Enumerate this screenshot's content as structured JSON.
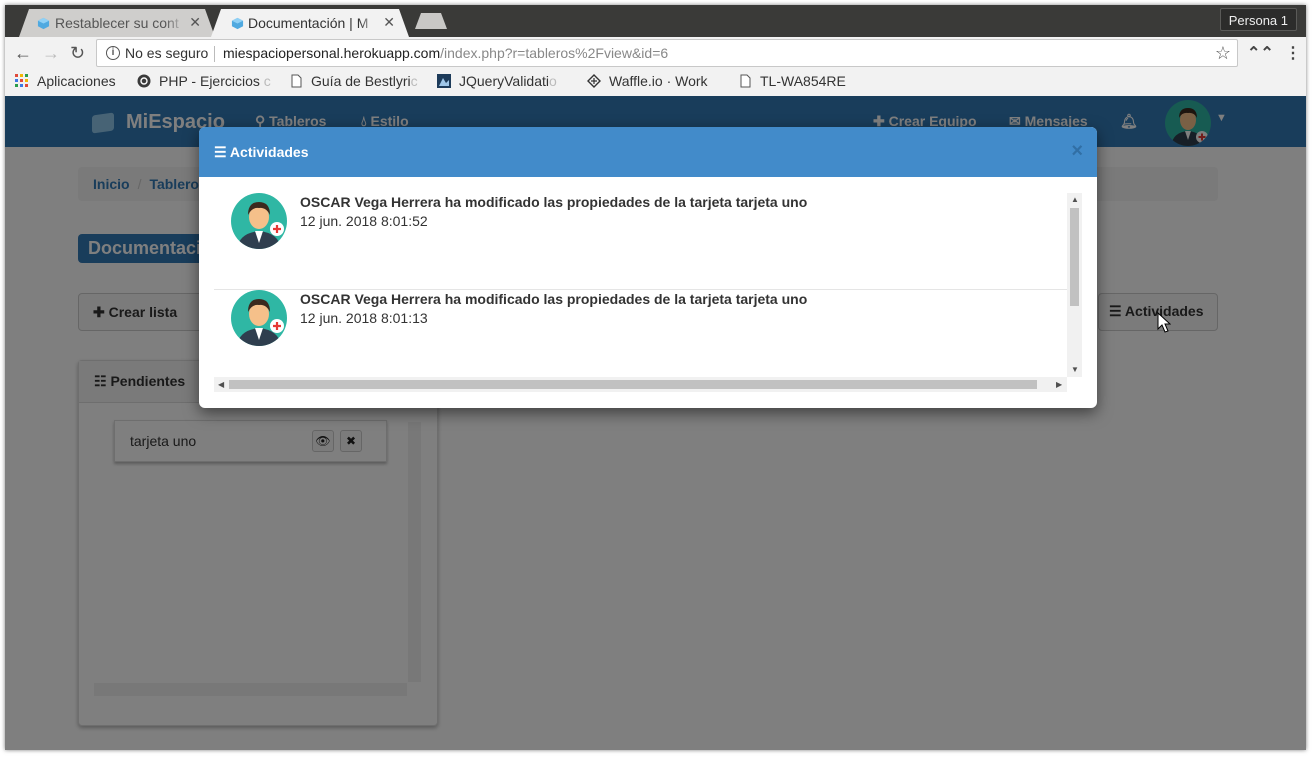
{
  "browser": {
    "tabs": [
      {
        "title": "Restablecer su cont",
        "active": false
      },
      {
        "title": "Documentación | M",
        "active": true
      }
    ],
    "profile": "Persona 1",
    "address": {
      "security": "No es seguro",
      "host": "miespaciopersonal.herokuapp.com",
      "path": "/index.php?r=tableros%2Fview&id=6"
    },
    "bookmarks": [
      {
        "label": "Aplicaciones",
        "icon": "apps-grid-icon"
      },
      {
        "label": "PHP - Ejercicios",
        "fade": " c",
        "icon": "php-globe-icon"
      },
      {
        "label": "Guía de Bestlyri",
        "fade": "c",
        "icon": "page-icon"
      },
      {
        "label": "JQueryValidati",
        "fade": "o",
        "icon": "jquery-image-icon"
      },
      {
        "label": "Waffle.io · Work",
        "icon": "waffle-icon"
      },
      {
        "label": "TL-WA854RE",
        "icon": "page-icon"
      }
    ]
  },
  "app": {
    "brand": "MiEspacio",
    "nav": {
      "tableros": "Tableros",
      "estilo": "Estilo",
      "crear_equipo": "Crear Equipo",
      "mensajes": "Mensajes"
    },
    "breadcrumb": {
      "inicio": "Inicio",
      "tableros": "Tablero"
    },
    "board_title": "Documentaci",
    "buttons": {
      "crear_lista": "Crear lista",
      "actividades": "Actividades"
    },
    "list": {
      "title": "Pendientes",
      "cards": [
        {
          "title": "tarjeta uno"
        }
      ]
    }
  },
  "modal": {
    "title": "Actividades",
    "close": "×",
    "activities": [
      {
        "text": "OSCAR Vega Herrera ha modificado las propiedades de la tarjeta tarjeta uno",
        "date": "12 jun. 2018 8:01:52"
      },
      {
        "text": "OSCAR Vega Herrera ha modificado las propiedades de la tarjeta tarjeta uno",
        "date": "12 jun. 2018 8:01:13"
      }
    ]
  },
  "colors": {
    "navbar": "#337ab7",
    "modal_header": "#428bca",
    "avatar_bg": "#2fb7a4"
  }
}
